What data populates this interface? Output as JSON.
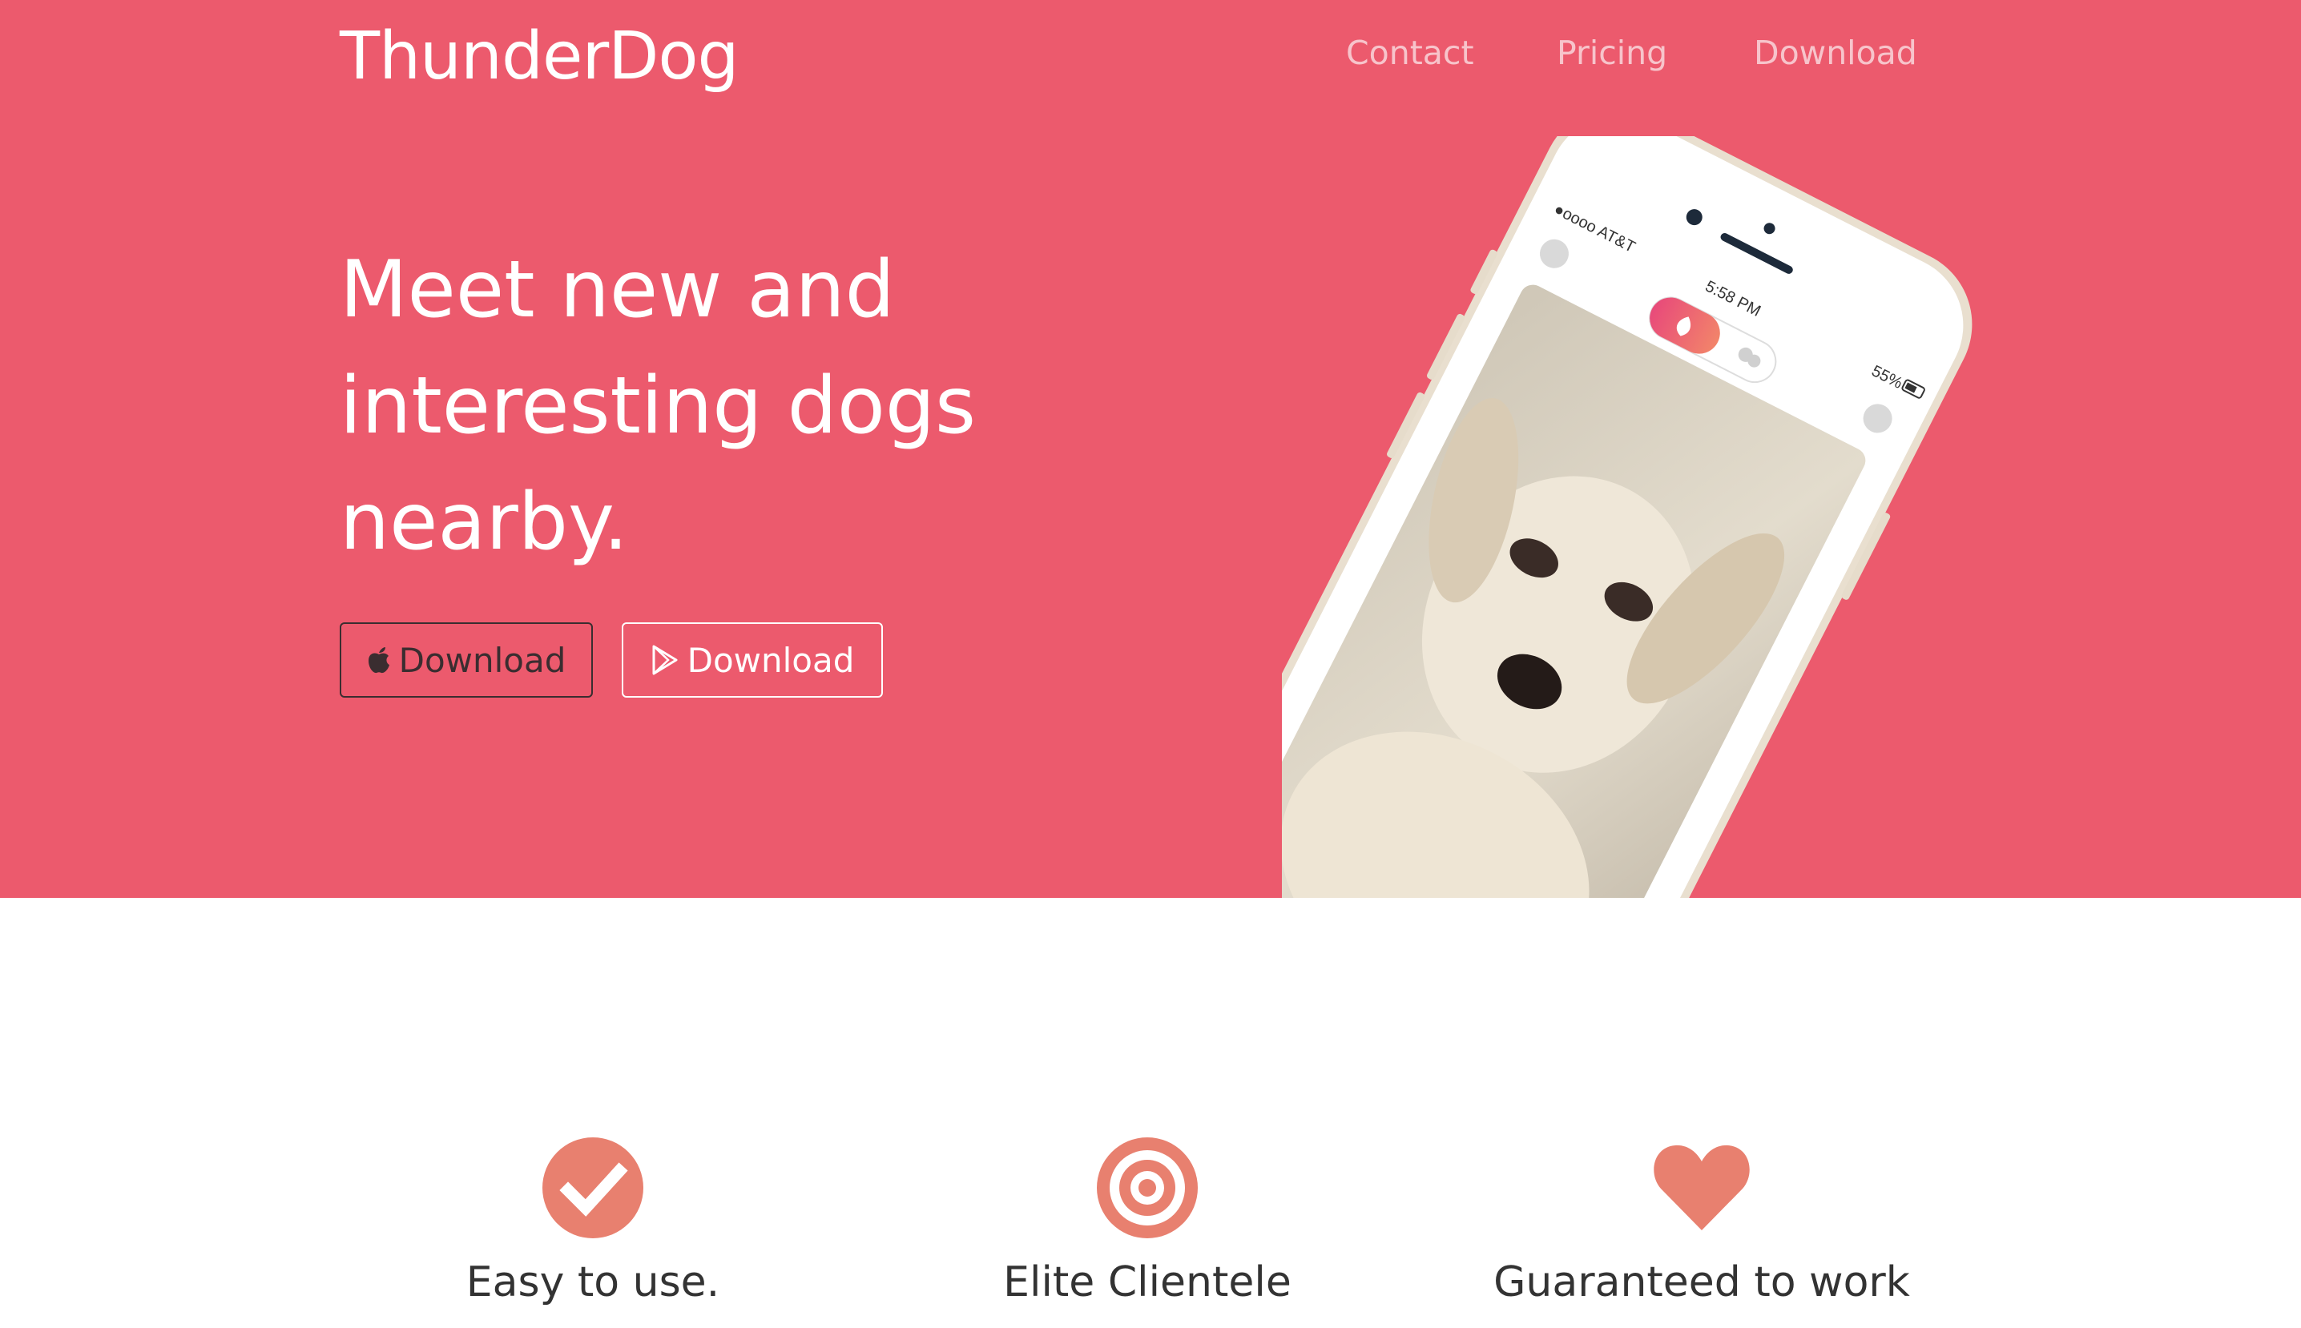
{
  "header": {
    "brand": "ThunderDog",
    "nav": [
      {
        "label": "Contact"
      },
      {
        "label": "Pricing"
      },
      {
        "label": "Download"
      }
    ]
  },
  "hero": {
    "headline_lines": [
      "Meet new and",
      "interesting dogs",
      "nearby."
    ],
    "buttons": {
      "apple_label": "Download",
      "play_label": "Download"
    },
    "phone": {
      "carrier": "●oooo AT&T",
      "time": "5:58 PM",
      "battery": "55%"
    }
  },
  "features": [
    {
      "title": "Easy to use.",
      "icon": "check-circle-icon"
    },
    {
      "title": "Elite Clientele",
      "icon": "target-icon"
    },
    {
      "title": "Guaranteed to work",
      "icon": "heart-icon"
    }
  ],
  "colors": {
    "hero_bg": "#ec5a6d",
    "icon_accent": "#e8806f",
    "dark_text": "#333333"
  }
}
